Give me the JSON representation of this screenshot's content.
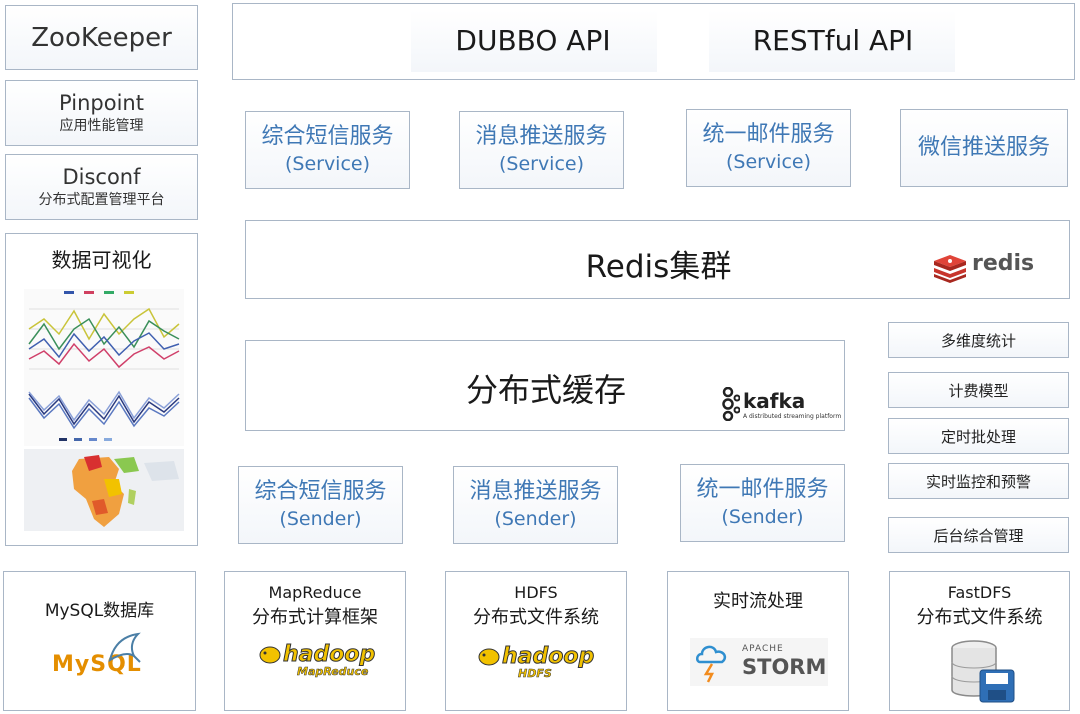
{
  "left": {
    "zookeeper": "ZooKeeper",
    "pinpoint": {
      "title": "Pinpoint",
      "subtitle": "应用性能管理"
    },
    "disconf": {
      "title": "Disconf",
      "subtitle": "分布式配置管理平台"
    },
    "viz": {
      "title": "数据可视化"
    }
  },
  "top": {
    "dubbo": "DUBBO API",
    "rest": "RESTful API"
  },
  "services": [
    {
      "title": "综合短信服务",
      "sub": "(Service)"
    },
    {
      "title": "消息推送服务",
      "sub": "(Service)"
    },
    {
      "title": "统一邮件服务",
      "sub": "(Service)"
    },
    {
      "title": "微信推送服务",
      "sub": ""
    }
  ],
  "redis": {
    "title": "Redis集群",
    "logo_text": "redis"
  },
  "cache": {
    "title": "分布式缓存",
    "logo_text": "kafka",
    "logo_sub": "A distributed streaming platform"
  },
  "senders": [
    {
      "title": "综合短信服务",
      "sub": "(Sender)"
    },
    {
      "title": "消息推送服务",
      "sub": "(Sender)"
    },
    {
      "title": "统一邮件服务",
      "sub": "(Sender)"
    }
  ],
  "right": [
    "多维度统计",
    "计费模型",
    "定时批处理",
    "实时监控和预警",
    "后台综合管理"
  ],
  "bottom": {
    "mysql": {
      "title": "MySQL数据库",
      "logo": "MySQL"
    },
    "mapreduce": {
      "line1": "MapReduce",
      "line2": "分布式计算框架",
      "logo": "hadoop",
      "logo_sub": "MapReduce"
    },
    "hdfs": {
      "line1": "HDFS",
      "line2": "分布式文件系统",
      "logo": "hadoop",
      "logo_sub": "HDFS"
    },
    "storm": {
      "title": "实时流处理",
      "logo_top": "APACHE",
      "logo": "STORM"
    },
    "fastdfs": {
      "line1": "FastDFS",
      "line2": "分布式文件系统"
    }
  },
  "colors": {
    "service_text": "#3f78b5",
    "border": "#a9b6c6",
    "redis_red": "#c8342b",
    "hadoop_yellow": "#f2c200"
  }
}
